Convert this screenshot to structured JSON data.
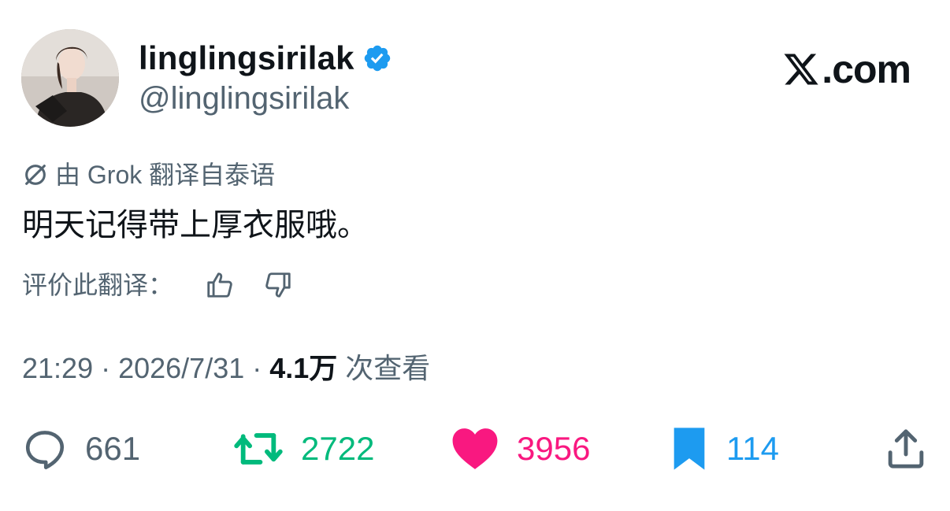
{
  "author": {
    "display_name": "linglingsirilak",
    "handle": "@linglingsirilak",
    "verified_icon": "verified-badge-icon"
  },
  "brand": {
    "text": ".com",
    "icon": "x-logo-icon"
  },
  "translation": {
    "icon": "grok-icon",
    "label": "由 Grok 翻译自泰语"
  },
  "tweet": {
    "text": "明天记得带上厚衣服哦。"
  },
  "rate": {
    "label": "评价此翻译：",
    "thumbs_up_icon": "thumbs-up-icon",
    "thumbs_down_icon": "thumbs-down-icon"
  },
  "meta": {
    "time": "21:29",
    "sep1": " · ",
    "date": "2026/7/31",
    "sep2": " · ",
    "views_count": "4.1万",
    "views_label": " 次查看"
  },
  "actions": {
    "reply_count": "661",
    "retweet_count": "2722",
    "like_count": "3956",
    "bookmark_count": "114"
  },
  "colors": {
    "text_primary": "#0f1419",
    "text_secondary": "#536471",
    "retweet": "#00ba7c",
    "like": "#f91880",
    "bookmark": "#1d9bf0",
    "verified": "#1d9bf0"
  }
}
